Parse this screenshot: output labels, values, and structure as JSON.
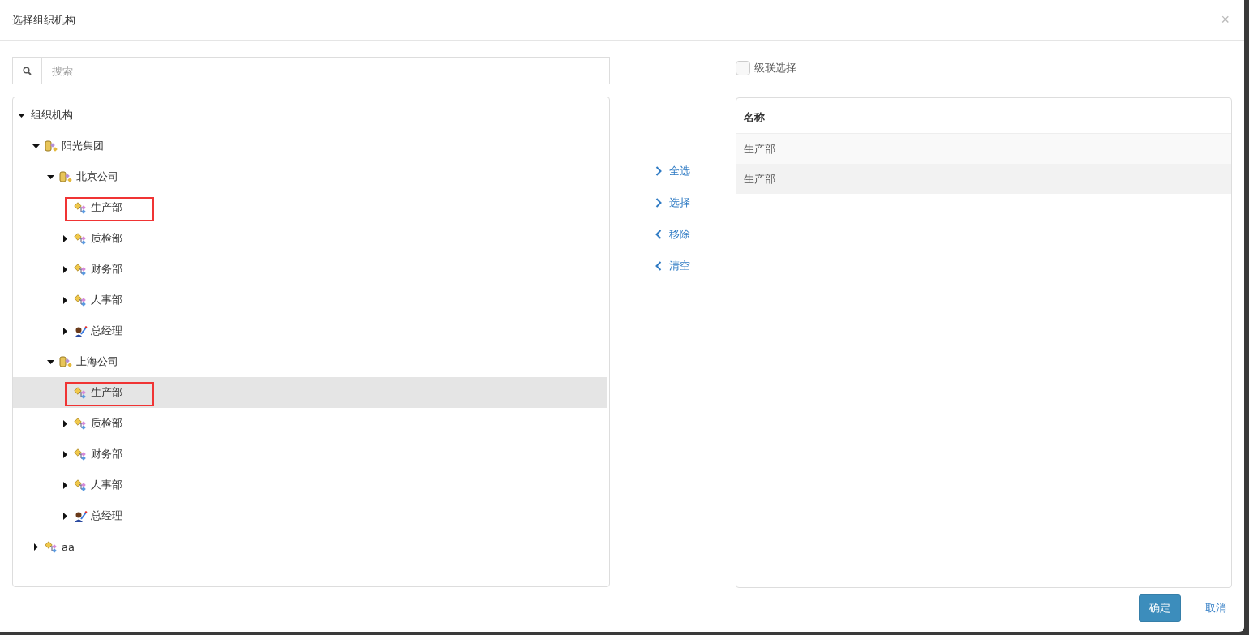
{
  "dialog": {
    "title": "选择组织机构",
    "close": "×"
  },
  "search": {
    "placeholder": "搜索"
  },
  "tree": [
    {
      "label": "组织机构",
      "expanded": true,
      "selected": false,
      "boxed": false,
      "children": [
        {
          "label": "阳光集团",
          "kind": "org",
          "expanded": true,
          "selected": false,
          "boxed": false,
          "children": [
            {
              "label": "北京公司",
              "kind": "org",
              "expanded": true,
              "selected": false,
              "boxed": false,
              "children": [
                {
                  "label": "生产部",
                  "kind": "dept",
                  "selected": false,
                  "boxed": true
                },
                {
                  "label": "质检部",
                  "kind": "dept",
                  "expanded": false,
                  "selected": false,
                  "boxed": false
                },
                {
                  "label": "财务部",
                  "kind": "dept",
                  "expanded": false,
                  "selected": false,
                  "boxed": false
                },
                {
                  "label": "人事部",
                  "kind": "dept",
                  "expanded": false,
                  "selected": false,
                  "boxed": false
                },
                {
                  "label": "总经理",
                  "kind": "person",
                  "expanded": false,
                  "selected": false,
                  "boxed": false
                }
              ]
            },
            {
              "label": "上海公司",
              "kind": "org",
              "expanded": true,
              "selected": false,
              "boxed": false,
              "children": [
                {
                  "label": "生产部",
                  "kind": "dept",
                  "selected": true,
                  "boxed": true
                },
                {
                  "label": "质检部",
                  "kind": "dept",
                  "expanded": false,
                  "selected": false,
                  "boxed": false
                },
                {
                  "label": "财务部",
                  "kind": "dept",
                  "expanded": false,
                  "selected": false,
                  "boxed": false
                },
                {
                  "label": "人事部",
                  "kind": "dept",
                  "expanded": false,
                  "selected": false,
                  "boxed": false
                },
                {
                  "label": "总经理",
                  "kind": "person",
                  "expanded": false,
                  "selected": false,
                  "boxed": false
                }
              ]
            }
          ]
        },
        {
          "label": "aa",
          "kind": "dept",
          "expanded": false,
          "selected": false,
          "boxed": false
        }
      ]
    }
  ],
  "actions": [
    {
      "label": "全选",
      "kind": "forward"
    },
    {
      "label": "选择",
      "kind": "forward"
    },
    {
      "label": "移除",
      "kind": "back"
    },
    {
      "label": "清空",
      "kind": "back"
    }
  ],
  "cascade": {
    "label": "级联选择",
    "checked": false
  },
  "table": {
    "columns": [
      "名称"
    ],
    "rows": [
      [
        "生产部"
      ],
      [
        "生产部"
      ]
    ]
  },
  "buttons": {
    "confirm": "确定",
    "cancel": "取消"
  }
}
